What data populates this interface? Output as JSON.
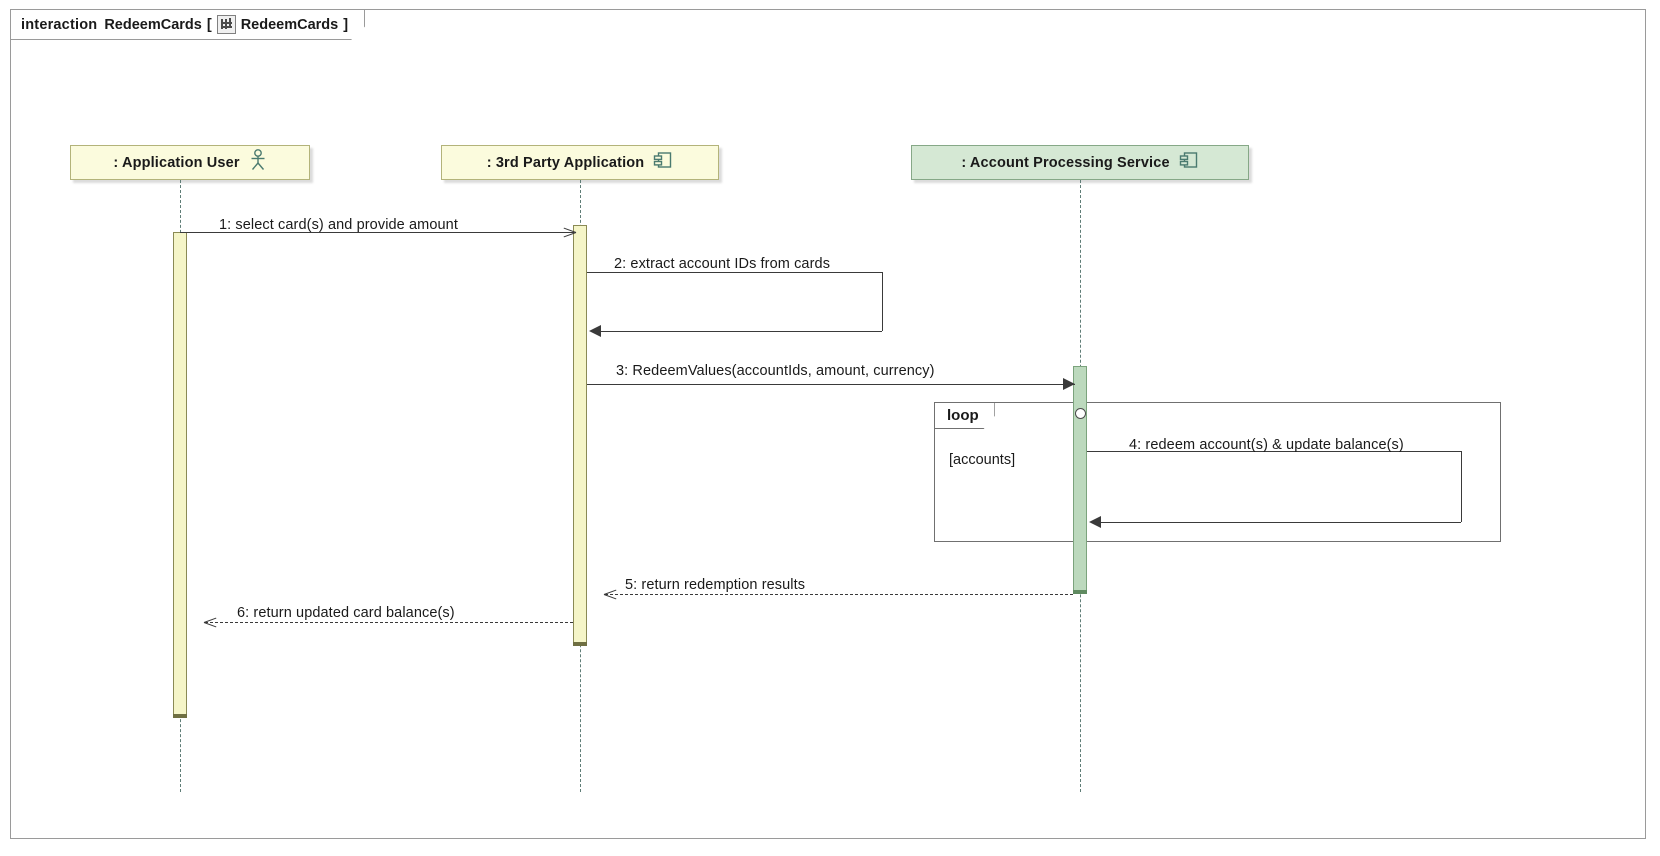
{
  "frame": {
    "keyword": "interaction",
    "name": "RedeemCards",
    "bracket_open": "[",
    "bracket_close": "]",
    "diagram_name": "RedeemCards",
    "icon": "interaction-diagram-icon"
  },
  "lifelines": [
    {
      "id": "application-user",
      "label": ": Application User",
      "icon": "actor-stick-figure-icon",
      "kind": "actor",
      "color": "#fbfbdd"
    },
    {
      "id": "third-party-application",
      "label": ": 3rd Party Application",
      "icon": "component-icon",
      "kind": "component",
      "color": "#fbfbdd"
    },
    {
      "id": "account-processing-service",
      "label": ": Account Processing Service",
      "icon": "component-icon",
      "kind": "component",
      "color": "#d5e8d4"
    }
  ],
  "messages": [
    {
      "number": "1",
      "label": "1: select card(s) and provide amount",
      "from": "application-user",
      "to": "third-party-application",
      "style": "solid",
      "arrow": "open"
    },
    {
      "number": "2",
      "label": "2: extract account IDs from cards",
      "from": "third-party-application",
      "to": "third-party-application",
      "style": "solid",
      "arrow": "filled",
      "self": true
    },
    {
      "number": "3",
      "label": "3: RedeemValues(accountIds, amount, currency)",
      "from": "third-party-application",
      "to": "account-processing-service",
      "style": "solid",
      "arrow": "filled"
    },
    {
      "number": "4",
      "label": "4: redeem account(s) & update balance(s)",
      "from": "account-processing-service",
      "to": "account-processing-service",
      "style": "solid",
      "arrow": "filled",
      "self": true
    },
    {
      "number": "5",
      "label": "5: return redemption results",
      "from": "account-processing-service",
      "to": "third-party-application",
      "style": "dashed",
      "arrow": "open"
    },
    {
      "number": "6",
      "label": "6: return updated card balance(s)",
      "from": "third-party-application",
      "to": "application-user",
      "style": "dashed",
      "arrow": "open"
    }
  ],
  "fragments": [
    {
      "id": "loop-fragment",
      "operator": "loop",
      "guard": "[accounts]"
    }
  ],
  "colors": {
    "actor_fill": "#fbfbdd",
    "service_fill": "#d5e8d4",
    "activation_yellow": "#f5f5c8",
    "activation_green": "#bcd9bd",
    "line": "#3a3a3a",
    "lifeline_dash": "#5f7d77",
    "frame_border": "#9a9a9a"
  }
}
